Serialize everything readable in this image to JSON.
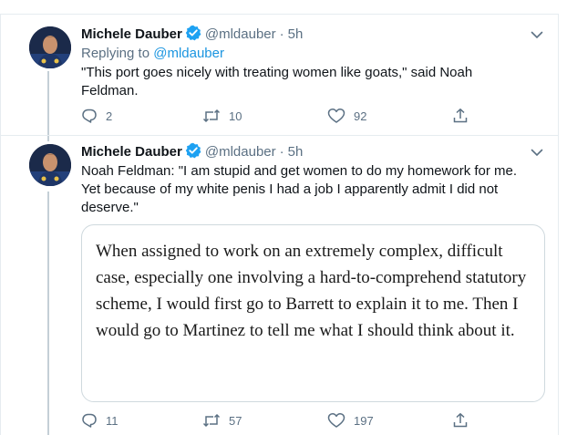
{
  "tweets": [
    {
      "author_name": "Michele Dauber",
      "handle": "@mldauber",
      "separator": "·",
      "time": "5h",
      "replying_prefix": "Replying to",
      "replying_handle": "@mldauber",
      "text": "\"This port goes nicely with treating women like goats,\" said Noah Feldman.",
      "replies": "2",
      "retweets": "10",
      "likes": "92"
    },
    {
      "author_name": "Michele Dauber",
      "handle": "@mldauber",
      "separator": "·",
      "time": "5h",
      "text": "Noah Feldman: \"I am stupid and get women to do my homework for me. Yet because of my white penis I had a job I apparently admit I did not deserve.\"",
      "quote_text": "When assigned to work on an extremely complex, difficult case, especially one involving a hard-to-comprehend statutory scheme, I would first go to Barrett to explain it to me. Then I would go to Martinez to tell me what I should think about it.",
      "replies": "11",
      "retweets": "57",
      "likes": "197"
    }
  ],
  "colors": {
    "accent": "#1da1f2",
    "mention": "#1b95e0",
    "secondary_text": "#5b7083",
    "divider": "#e6ecf0"
  },
  "icons": {
    "verified": "verified-badge-icon",
    "more": "chevron-down-icon",
    "reply": "reply-icon",
    "retweet": "retweet-icon",
    "like": "heart-icon",
    "share": "share-icon"
  }
}
